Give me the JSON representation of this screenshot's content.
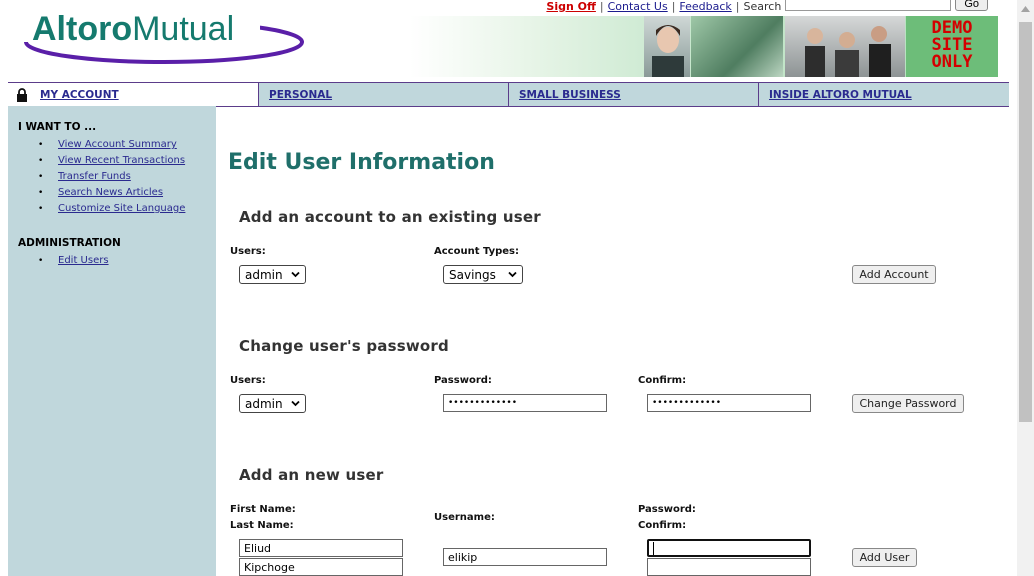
{
  "header": {
    "logo_text_bold": "Altoro",
    "logo_text_light": "Mutual",
    "sign_off": "Sign Off",
    "contact_us": "Contact Us",
    "feedback": "Feedback",
    "search_label": "Search",
    "search_value": "",
    "go_button": "Go",
    "demo_badge_line1": "DEMO",
    "demo_badge_line2": "SITE",
    "demo_badge_line3": "ONLY"
  },
  "nav": {
    "my_account": "MY ACCOUNT",
    "personal": "PERSONAL",
    "small_business": "SMALL BUSINESS",
    "inside": "INSIDE ALTORO MUTUAL"
  },
  "sidebar": {
    "i_want_to": "I WANT TO ...",
    "items": [
      {
        "label": "View Account Summary"
      },
      {
        "label": "View Recent Transactions"
      },
      {
        "label": "Transfer Funds"
      },
      {
        "label": "Search News Articles"
      },
      {
        "label": "Customize Site Language"
      }
    ],
    "admin_heading": "ADMINISTRATION",
    "admin_items": [
      {
        "label": "Edit Users"
      }
    ]
  },
  "main": {
    "title": "Edit User Information",
    "add_account": {
      "heading": "Add an account to an existing user",
      "users_label": "Users:",
      "users_value": "admin",
      "account_types_label": "Account Types:",
      "account_type_value": "Savings",
      "button": "Add Account"
    },
    "change_password": {
      "heading": "Change user's password",
      "users_label": "Users:",
      "users_value": "admin",
      "password_label": "Password:",
      "password_value": "•••••••••••••",
      "confirm_label": "Confirm:",
      "confirm_value": "•••••••••••••",
      "button": "Change Password"
    },
    "add_user": {
      "heading": "Add an new user",
      "first_name_label": "First Name:",
      "last_name_label": "Last Name:",
      "first_name_value": "Eliud",
      "last_name_value": "Kipchoge",
      "username_label": "Username:",
      "username_value": "elikip",
      "password_label": "Password:",
      "confirm_label": "Confirm:",
      "password_value": "",
      "confirm_value": "",
      "button": "Add User"
    }
  },
  "colors": {
    "brand_teal": "#1f6f6a",
    "nav_bg": "#c0d7dc",
    "nav_border": "#5b3c8a",
    "demo_red": "#d40000",
    "demo_green": "#6dbd79"
  }
}
